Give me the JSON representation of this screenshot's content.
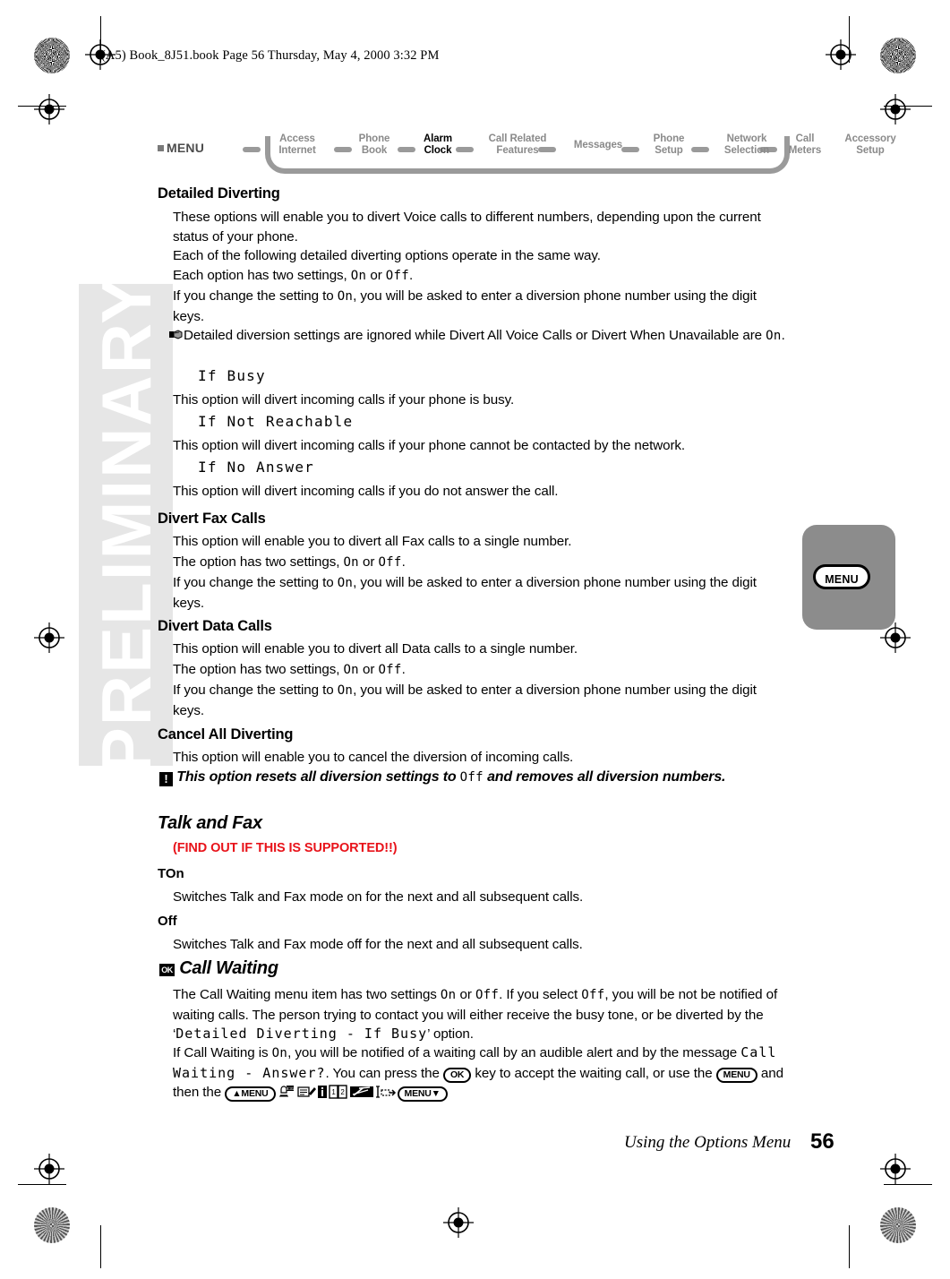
{
  "header": {
    "file_line": "(A5) Book_8J51.book  Page 56  Thursday, May 4, 2000  3:32 PM"
  },
  "watermark": {
    "text": "PRELIMINARY"
  },
  "nav": {
    "menu_label": "MENU",
    "items": [
      {
        "line1": "Access",
        "line2": "Internet",
        "active": false
      },
      {
        "line1": "Phone",
        "line2": "Book",
        "active": false
      },
      {
        "line1": "Alarm",
        "line2": "Clock",
        "active": true
      },
      {
        "line1": "Call Related",
        "line2": "Features",
        "active": false
      },
      {
        "line1": "Messages",
        "line2": "",
        "active": false
      },
      {
        "line1": "Phone",
        "line2": "Setup",
        "active": false
      },
      {
        "line1": "Network",
        "line2": "Selection",
        "active": false
      },
      {
        "line1": "Call",
        "line2": "Meters",
        "active": false
      },
      {
        "line1": "Accessory",
        "line2": "Setup",
        "active": false
      }
    ]
  },
  "sections": {
    "detailed_diverting": {
      "heading": "Detailed Diverting",
      "p1": "These options will enable you to divert Voice calls to different numbers, depending upon the current status of your phone.",
      "p2": "Each of the following detailed diverting options operate in the same way.",
      "p3_a": "Each option has two settings, ",
      "p3_on": "On",
      "p3_b": " or ",
      "p3_off": "Off",
      "p3_c": ".",
      "p4_a": "If you change the setting to ",
      "p4_on": "On",
      "p4_b": ", you will be asked to enter a diversion phone number using the digit keys.",
      "note_a": "Detailed diversion settings are ignored while Divert All Voice Calls or Divert When Unavailable are ",
      "note_on": "On",
      "note_b": ".",
      "opt1_title": "If Busy",
      "opt1_text": "This option will divert incoming calls if your phone is busy.",
      "opt2_title": "If Not Reachable",
      "opt2_text": "This option will divert incoming calls if your phone cannot be contacted by the network.",
      "opt3_title": "If No Answer",
      "opt3_text": "This option will divert incoming calls if you do not answer the call."
    },
    "divert_fax": {
      "heading": "Divert Fax Calls",
      "p1": "This option will enable you to divert all Fax calls to a single number.",
      "p2_a": "The option has two settings, ",
      "p2_on": "On",
      "p2_b": " or ",
      "p2_off": "Off",
      "p2_c": ".",
      "p3_a": "If you change the setting to ",
      "p3_on": "On",
      "p3_b": ", you will be asked to enter a diversion phone number using the digit keys."
    },
    "divert_data": {
      "heading": "Divert Data Calls",
      "p1": "This option will enable you to divert all Data calls to a single number.",
      "p2_a": "The option has two settings, ",
      "p2_on": "On",
      "p2_b": " or ",
      "p2_off": "Off",
      "p2_c": ".",
      "p3_a": "If you change the setting to ",
      "p3_on": "On",
      "p3_b": ", you will be asked to enter a diversion phone number using the digit keys."
    },
    "cancel_all": {
      "heading": "Cancel All Diverting",
      "p1": "This option will enable you to cancel the diversion of incoming calls.",
      "warn_a": "This option resets all diversion settings to ",
      "warn_off": "Off",
      "warn_b": " and removes all diversion numbers."
    },
    "talk_and_fax": {
      "heading": "Talk and Fax",
      "editor_note": "(FIND OUT IF THIS IS SUPPORTED!!)",
      "sub1_title": "TOn",
      "sub1_text": "Switches Talk and Fax mode on for the next and all subsequent calls.",
      "sub2_title": "Off",
      "sub2_text": "Switches Talk and Fax mode off for the next and all subsequent calls."
    },
    "call_waiting": {
      "badge": "OK",
      "heading": "Call Waiting",
      "p1_a": "The Call Waiting menu item has two settings ",
      "p1_on": "On",
      "p1_b": " or ",
      "p1_off": "Off",
      "p1_c": ". If you select ",
      "p1_off2": "Off",
      "p1_d": ", you will be not be notified of waiting calls. The person trying to contact you will either receive the busy tone, or be diverted by the ‘",
      "p1_lcd": "Detailed Diverting - If Busy",
      "p1_e": "’ option.",
      "p2_a": "If Call Waiting is ",
      "p2_on": "On",
      "p2_b": ", you will be notified of a waiting call by an audible alert and by the message ",
      "p2_lcd": "Call Waiting - Answer?",
      "p2_c": ". You can press the ",
      "p2_key_ok": "OK",
      "p2_d": " key to accept the waiting call, or use the ",
      "p2_key_menu": "MENU",
      "p2_e": " and then the ",
      "p2_key_menu_up": "▲MENU",
      "p2_key_menu_down": "MENU▼",
      "icons": [
        "alarm-bell-icon",
        "message-compose-icon",
        "info-icon",
        "phonebook-icon",
        "lightning-icon",
        "call-divert-icon"
      ]
    }
  },
  "side_tab": {
    "label": "MENU"
  },
  "footer": {
    "title": "Using the Options Menu",
    "page": "56"
  }
}
